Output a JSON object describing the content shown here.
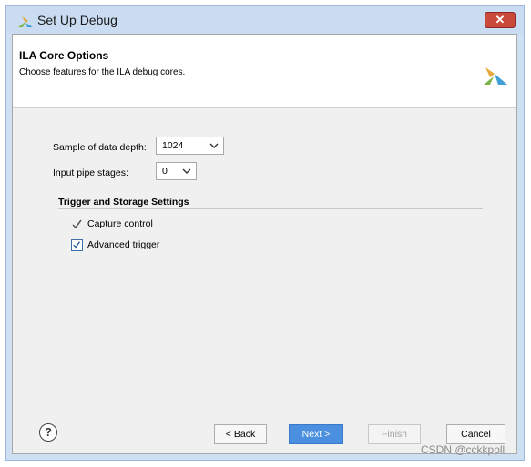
{
  "window": {
    "title": "Set Up Debug",
    "close_glyph": "✕"
  },
  "header": {
    "title": "ILA Core Options",
    "subtitle": "Choose features for the ILA debug cores.",
    "logo_icon": "xilinx-logo-icon"
  },
  "options": {
    "data_depth_label": "Sample of data depth:",
    "data_depth_value": "1024",
    "pipe_stages_label": "Input pipe stages:",
    "pipe_stages_value": "0"
  },
  "trigger_section": {
    "title": "Trigger and Storage Settings",
    "items": [
      {
        "label": "Capture control",
        "checked": true
      },
      {
        "label": "Advanced trigger",
        "checked": true
      }
    ]
  },
  "footer": {
    "help_glyph": "?",
    "back_label": "< Back",
    "next_label": "Next >",
    "finish_label": "Finish",
    "cancel_label": "Cancel"
  },
  "watermark": "CSDN @cckkppll",
  "colors": {
    "titlebar": "#c9dcf2",
    "close_button": "#c94a3a",
    "primary_button": "#4a8fe0",
    "checkbox_accent": "#3c6ea8"
  }
}
